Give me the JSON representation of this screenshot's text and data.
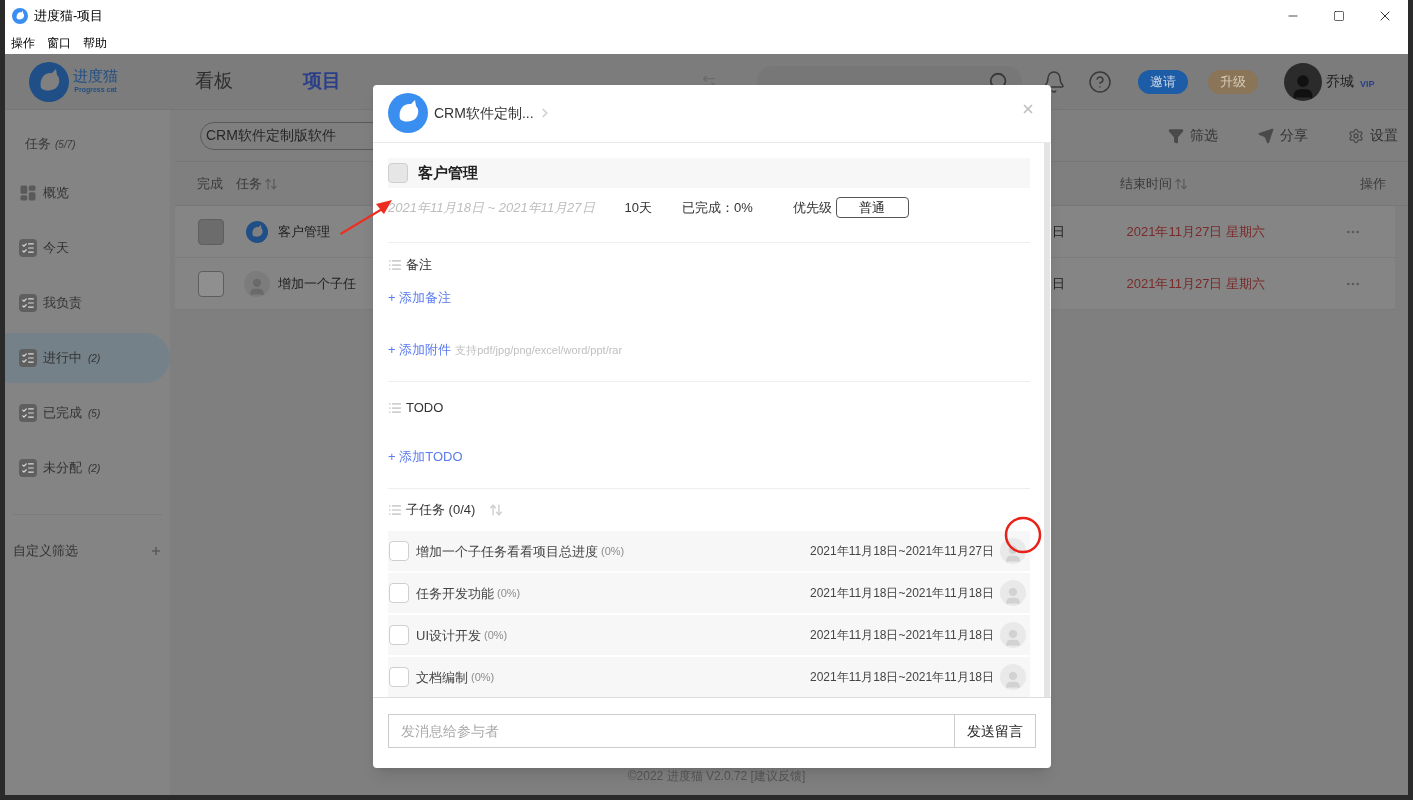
{
  "window": {
    "title": "进度猫-项目",
    "menu": [
      "操作",
      "窗口",
      "帮助"
    ]
  },
  "header": {
    "logo_text": "进度猫",
    "logo_subtext": "Progress cat",
    "nav": [
      {
        "label": "看板",
        "selected": false
      },
      {
        "label": "项目",
        "selected": true
      }
    ],
    "invite": "邀请",
    "upgrade": "升级",
    "user": {
      "name": "乔城",
      "badge": "VIP"
    }
  },
  "sidebar": {
    "title": "任务",
    "count": "(5/7)",
    "items": [
      {
        "kind": "overview",
        "label": "概览",
        "selected": false
      },
      {
        "kind": "list",
        "label": "今天",
        "selected": false
      },
      {
        "kind": "list",
        "label": "我负责",
        "selected": false
      },
      {
        "kind": "list",
        "label": "进行中",
        "count": "(2)",
        "selected": true
      },
      {
        "kind": "list",
        "label": "已完成",
        "count": "(5)",
        "selected": false
      },
      {
        "kind": "list",
        "label": "未分配",
        "count": "(2)",
        "selected": false
      }
    ],
    "custom_filter": "自定义筛选"
  },
  "toolbar": {
    "project": "CRM软件定制版软件",
    "actions": [
      {
        "kind": "filter",
        "label": "筛选"
      },
      {
        "kind": "share",
        "label": "分享"
      },
      {
        "kind": "settings",
        "label": "设置"
      }
    ]
  },
  "table": {
    "columns": [
      "完成",
      "任务",
      "结束时间",
      "操作"
    ],
    "rows": [
      {
        "highlighted": true,
        "kind": "logo",
        "task": "客户管理",
        "column_3": "日",
        "end_time": "2021年11月27日 星期六"
      },
      {
        "highlighted": false,
        "kind": "person",
        "task": "增加一个子任",
        "column_3": "日",
        "end_time": "2021年11月27日 星期六"
      }
    ]
  },
  "footer": "©2022 进度猫 V2.0.72  [建议反馈]",
  "modal": {
    "breadcrumb": "CRM软件定制...",
    "task": {
      "title": "客户管理",
      "checked": false,
      "dates": "2021年11月18日 ~ 2021年11月27日",
      "duration": "10天",
      "progress": "已完成：0%",
      "priority_label": "优先级",
      "priority": "普通"
    },
    "notes": {
      "title": "备注",
      "add": "+ 添加备注"
    },
    "attachment": {
      "add": "+ 添加附件",
      "hint": "支持pdf/jpg/png/excel/word/ppt/rar"
    },
    "todo": {
      "title": "TODO",
      "add": "+ 添加TODO"
    },
    "subtasks": {
      "title": "子任务 (0/4)",
      "items": [
        {
          "name": "增加一个子任务看看项目总进度",
          "progress": "(0%)",
          "dates": "2021年11月18日~2021年11月27日",
          "checked": false
        },
        {
          "name": "任务开发功能",
          "progress": "(0%)",
          "dates": "2021年11月18日~2021年11月18日",
          "checked": false
        },
        {
          "name": "UI设计开发",
          "progress": "(0%)",
          "dates": "2021年11月18日~2021年11月18日",
          "checked": false
        },
        {
          "name": "文档编制",
          "progress": "(0%)",
          "dates": "2021年11月18日~2021年11月18日",
          "checked": false
        }
      ]
    },
    "message": {
      "placeholder": "发消息给参与者",
      "send": "发送留言"
    }
  }
}
